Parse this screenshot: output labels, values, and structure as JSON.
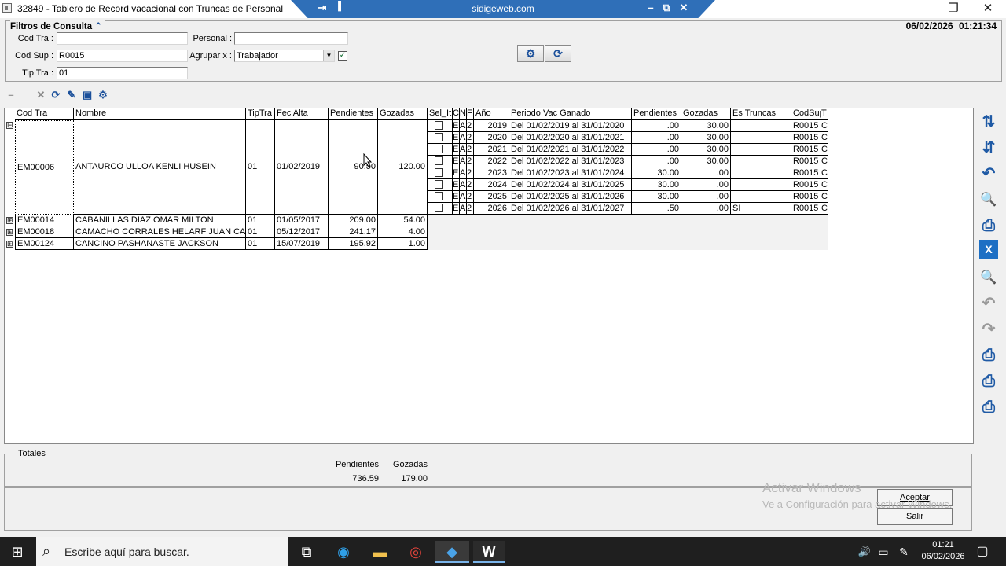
{
  "window": {
    "title": "32849 - Tablero de Record vacacional con Truncas de Personal"
  },
  "remote": {
    "host": "sidigeweb.com",
    "pin": "⇥",
    "signal": "▐",
    "min": "–",
    "restore": "⧉",
    "close": "✕"
  },
  "window_controls": {
    "restore": "❐",
    "close": "✕"
  },
  "datetime": "06/02/2026  01:21:34",
  "filters": {
    "title": "Filtros de Consulta",
    "collapse_glyph": "⌃",
    "cod_tra_label": "Cod Tra :",
    "cod_tra_value": "",
    "personal_label": "Personal :",
    "personal_value": "",
    "cod_sup_label": "Cod Sup :",
    "cod_sup_value": "R0015",
    "agrupar_label": "Agrupar x :",
    "agrupar_value": "Trabajador",
    "agrupar_checked": "✓",
    "tip_tra_label": "Tip Tra :",
    "tip_tra_value": "01"
  },
  "toolbar_icons": {
    "minus": "–",
    "delete": "✕",
    "refresh": "⟳",
    "pin": "✎",
    "save": "▣",
    "settings": "⚙",
    "gear_btn": "⚙",
    "refresh_btn": "⟳"
  },
  "main_grid": {
    "headers": [
      "Cod Tra",
      "Nombre",
      "TipTra",
      "Fec Alta",
      "Pendientes",
      "Gozadas"
    ],
    "rows": [
      {
        "expander": "⊟",
        "cod": "EM00006",
        "nombre": "ANTAURCO ULLOA KENLI HUSEIN",
        "tiptra": "01",
        "fec": "01/02/2019",
        "pend": "90.50",
        "goz": "120.00"
      },
      {
        "expander": "⊞",
        "cod": "EM00014",
        "nombre": "CABANILLAS DIAZ OMAR MILTON",
        "tiptra": "01",
        "fec": "01/05/2017",
        "pend": "209.00",
        "goz": "54.00"
      },
      {
        "expander": "⊞",
        "cod": "EM00018",
        "nombre": "CAMACHO CORRALES HELARF JUAN CARLC",
        "tiptra": "01",
        "fec": "05/12/2017",
        "pend": "241.17",
        "goz": "4.00"
      },
      {
        "expander": "⊞",
        "cod": "EM00124",
        "nombre": "CANCINO PASHANASTE JACKSON",
        "tiptra": "01",
        "fec": "15/07/2019",
        "pend": "195.92",
        "goz": "1.00"
      }
    ]
  },
  "detail_grid": {
    "headers": [
      "Sel_It",
      "C",
      "N",
      "F",
      "Año",
      "Periodo Vac Ganado",
      "Pendientes",
      "Gozadas",
      "Es Truncas",
      "CodSup",
      "T"
    ],
    "rows": [
      {
        "c": "E",
        "n": "A",
        "f": "2",
        "anio": "2019",
        "periodo": "Del 01/02/2019 al 31/01/2020",
        "pend": ".00",
        "goz": "30.00",
        "truncas": "",
        "codsup": "R0015",
        "t": "C"
      },
      {
        "c": "E",
        "n": "A",
        "f": "2",
        "anio": "2020",
        "periodo": "Del 01/02/2020 al 31/01/2021",
        "pend": ".00",
        "goz": "30.00",
        "truncas": "",
        "codsup": "R0015",
        "t": "C"
      },
      {
        "c": "E",
        "n": "A",
        "f": "2",
        "anio": "2021",
        "periodo": "Del 01/02/2021 al 31/01/2022",
        "pend": ".00",
        "goz": "30.00",
        "truncas": "",
        "codsup": "R0015",
        "t": "C"
      },
      {
        "c": "E",
        "n": "A",
        "f": "2",
        "anio": "2022",
        "periodo": "Del 01/02/2022 al 31/01/2023",
        "pend": ".00",
        "goz": "30.00",
        "truncas": "",
        "codsup": "R0015",
        "t": "C"
      },
      {
        "c": "E",
        "n": "A",
        "f": "2",
        "anio": "2023",
        "periodo": "Del 01/02/2023 al 31/01/2024",
        "pend": "30.00",
        "goz": ".00",
        "truncas": "",
        "codsup": "R0015",
        "t": "C"
      },
      {
        "c": "E",
        "n": "A",
        "f": "2",
        "anio": "2024",
        "periodo": "Del 01/02/2024 al 31/01/2025",
        "pend": "30.00",
        "goz": ".00",
        "truncas": "",
        "codsup": "R0015",
        "t": "C"
      },
      {
        "c": "E",
        "n": "A",
        "f": "2",
        "anio": "2025",
        "periodo": "Del 01/02/2025 al 31/01/2026",
        "pend": "30.00",
        "goz": ".00",
        "truncas": "",
        "codsup": "R0015",
        "t": "C"
      },
      {
        "c": "E",
        "n": "A",
        "f": "2",
        "anio": "2026",
        "periodo": "Del 01/02/2026 al 31/01/2027",
        "pend": ".50",
        "goz": ".00",
        "truncas": "SI",
        "codsup": "R0015",
        "t": "C"
      }
    ]
  },
  "side_icons": [
    {
      "name": "sort-ascending-icon",
      "glyph": "⇅"
    },
    {
      "name": "sort-descending-icon",
      "glyph": "⇵"
    },
    {
      "name": "undo-icon",
      "glyph": "↶"
    },
    {
      "name": "search-icon",
      "glyph": "🔍"
    },
    {
      "name": "print-icon",
      "glyph": "⎙"
    },
    {
      "name": "export-excel-icon",
      "glyph": "X"
    },
    {
      "name": "search-icon",
      "glyph": "🔍"
    },
    {
      "name": "undo-icon",
      "glyph": "↶"
    },
    {
      "name": "redo-icon",
      "glyph": "↷"
    },
    {
      "name": "print-icon",
      "glyph": "⎙"
    },
    {
      "name": "print-icon",
      "glyph": "⎙"
    },
    {
      "name": "print-icon",
      "glyph": "⎙"
    }
  ],
  "totals": {
    "title": "Totales",
    "pend_label": "Pendientes",
    "goz_label": "Gozadas",
    "pend_value": "736.59",
    "goz_value": "179.00"
  },
  "buttons": {
    "accept": "Aceptar",
    "exit": "Salir"
  },
  "watermark": {
    "line1": "Activar Windows",
    "line2": "Ve a Configuración para activar Windows."
  },
  "taskbar": {
    "search_placeholder": "Escribe aquí para buscar.",
    "time": "01:21",
    "date": "06/02/2026",
    "icons": {
      "start": "⊞",
      "search": "⌕",
      "taskview": "⧉",
      "edge": "◉",
      "explorer": "▬",
      "chrome": "◎",
      "remote": "◆",
      "word": "W",
      "volume": "🔊",
      "network": "▭",
      "pen": "✎",
      "notifications": "▢"
    }
  }
}
